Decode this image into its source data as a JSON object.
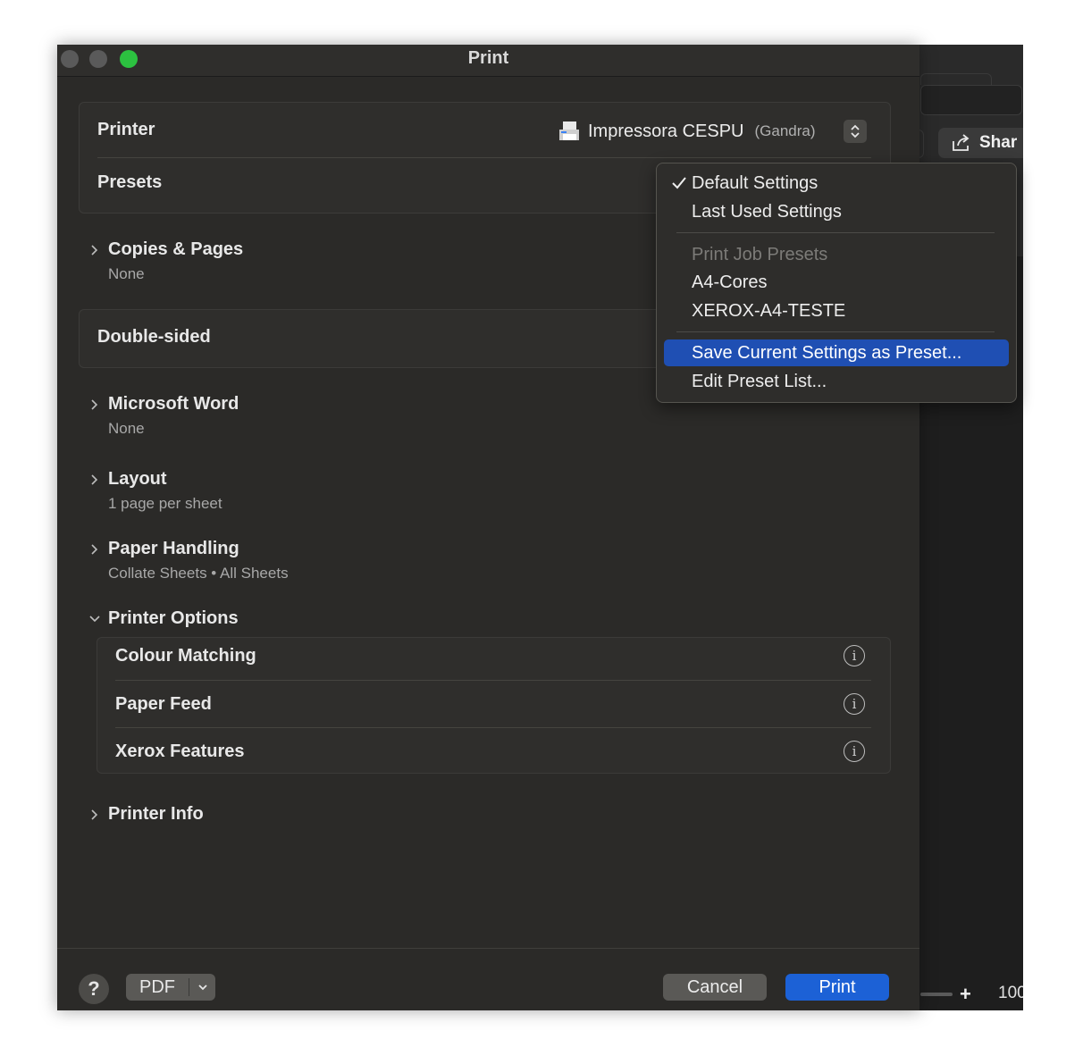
{
  "window": {
    "title": "Print",
    "traffic_lights": [
      "close",
      "minimize",
      "zoom"
    ]
  },
  "printer": {
    "label": "Printer",
    "name": "Impressora CESPU",
    "location": "(Gandra)",
    "icon": "printer-icon"
  },
  "presets": {
    "label": "Presets"
  },
  "sections": {
    "copies": {
      "title": "Copies & Pages",
      "subtitle": "None"
    },
    "double_sided": {
      "label": "Double-sided"
    },
    "word": {
      "title": "Microsoft Word",
      "subtitle": "None"
    },
    "layout": {
      "title": "Layout",
      "subtitle": "1 page per sheet"
    },
    "paper": {
      "title": "Paper Handling",
      "subtitle": "Collate Sheets • All Sheets"
    },
    "printer_options": {
      "title": "Printer Options",
      "items": [
        {
          "label": "Colour Matching"
        },
        {
          "label": "Paper Feed"
        },
        {
          "label": "Xerox Features"
        }
      ]
    },
    "printer_info": {
      "title": "Printer Info"
    }
  },
  "footer": {
    "help": "?",
    "pdf": "PDF",
    "cancel": "Cancel",
    "print": "Print"
  },
  "menu": {
    "items": [
      {
        "label": "Default Settings",
        "checked": true
      },
      {
        "label": "Last Used Settings"
      },
      {
        "label": "Print Job Presets",
        "disabled": true
      },
      {
        "label": "A4-Cores"
      },
      {
        "label": "XEROX-A4-TESTE"
      },
      {
        "label": "Save Current Settings as Preset...",
        "selected": true
      },
      {
        "label": "Edit Preset List..."
      }
    ]
  },
  "background_window": {
    "share_label": "Shar",
    "zoom_text": "100",
    "plus": "+"
  },
  "colors": {
    "accent": "#1c61d6",
    "menu_selected": "#1f4fb3",
    "dialog_bg": "#2b2a28",
    "zoom_light": "#2cc140"
  }
}
